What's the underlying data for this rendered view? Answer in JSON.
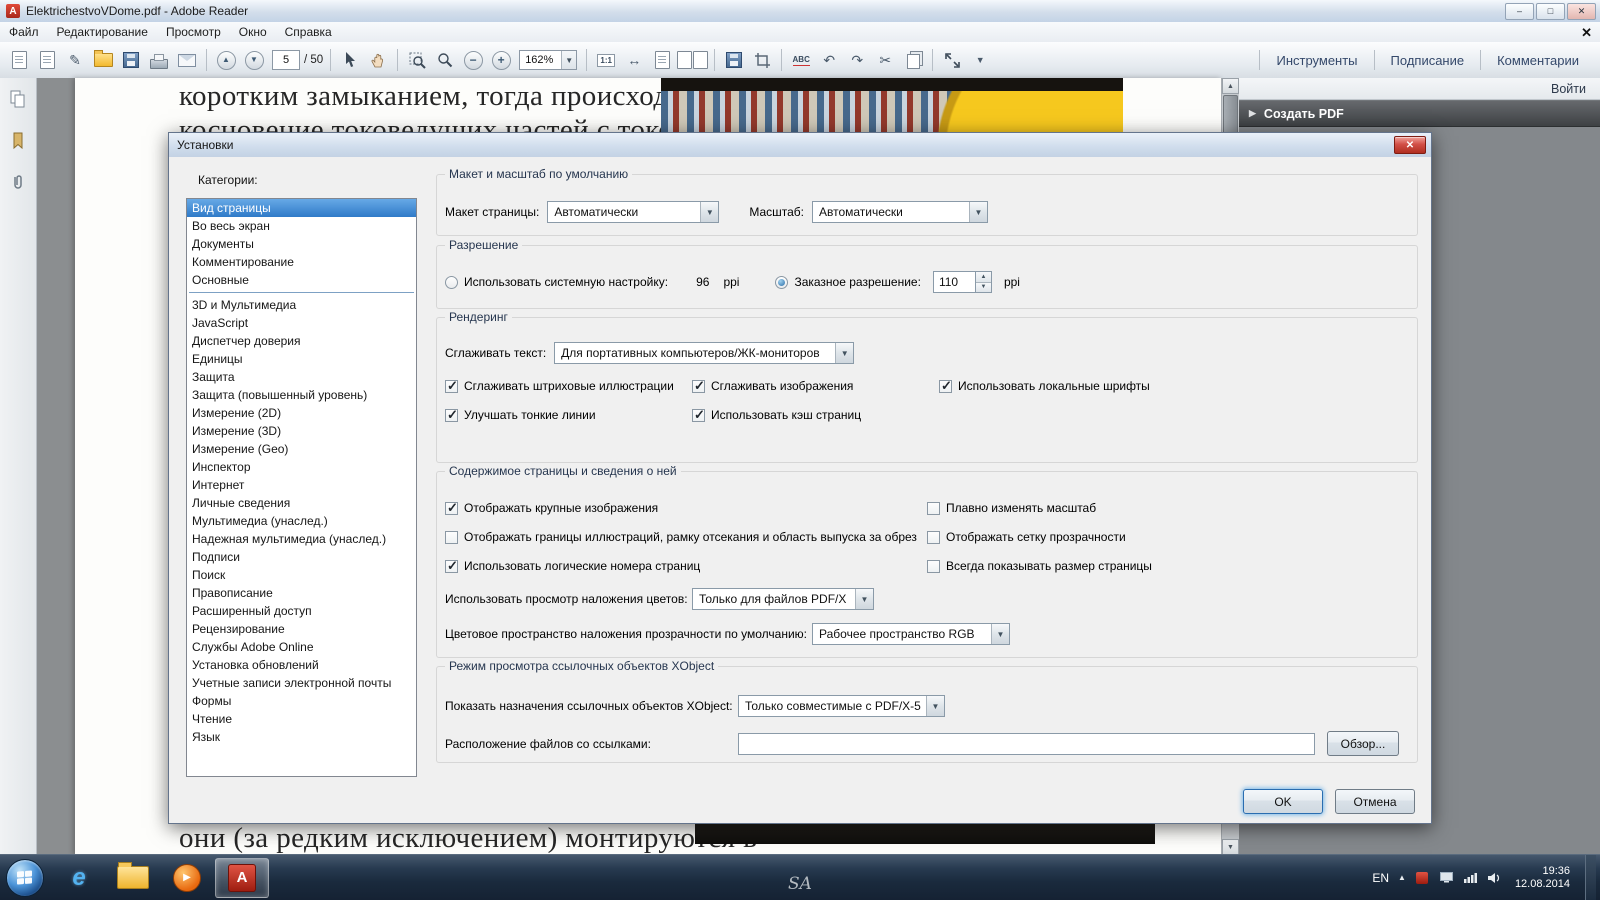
{
  "titlebar": {
    "title": "ElektrichestvoVDome.pdf - Adobe Reader"
  },
  "menubar": {
    "items": [
      "Файл",
      "Редактирование",
      "Просмотр",
      "Окно",
      "Справка"
    ]
  },
  "toolbar": {
    "page_current": "5",
    "page_total": "/ 50",
    "zoom": "162%",
    "links": [
      "Инструменты",
      "Подписание",
      "Комментарии"
    ]
  },
  "panel": {
    "signin": "Войти",
    "create_pdf": "Создать PDF"
  },
  "document": {
    "top_line1": "коротким замыканием, тогда происходит сопри-",
    "top_line2": "косновение токоведущих частей с токопрово-",
    "bottom_line": "они (за редким исключением) монтируются в"
  },
  "dialog": {
    "title": "Установки",
    "categories_label": "Категории:",
    "categories": [
      "Вид страницы",
      "Во весь экран",
      "Документы",
      "Комментирование",
      "Основные",
      "3D и Мультимедиа",
      "JavaScript",
      "Диспетчер доверия",
      "Единицы",
      "Защита",
      "Защита (повышенный уровень)",
      "Измерение (2D)",
      "Измерение (3D)",
      "Измерение (Geo)",
      "Инспектор",
      "Интернет",
      "Личные сведения",
      "Мультимедиа (унаслед.)",
      "Надежная мультимедиа (унаслед.)",
      "Подписи",
      "Поиск",
      "Правописание",
      "Расширенный доступ",
      "Рецензирование",
      "Службы Adobe Online",
      "Установка обновлений",
      "Учетные записи электронной почты",
      "Формы",
      "Чтение",
      "Язык"
    ],
    "layout_group": {
      "title": "Макет и масштаб по умолчанию",
      "page_layout_label": "Макет страницы:",
      "page_layout_value": "Автоматически",
      "zoom_label": "Масштаб:",
      "zoom_value": "Автоматически"
    },
    "resolution_group": {
      "title": "Разрешение",
      "system_label": "Использовать системную настройку:",
      "system_value": "96",
      "system_unit": "ppi",
      "custom_label": "Заказное разрешение:",
      "custom_value": "110",
      "custom_unit": "ppi"
    },
    "rendering_group": {
      "title": "Рендеринг",
      "smooth_text_label": "Сглаживать текст:",
      "smooth_text_value": "Для портативных компьютеров/ЖК-мониторов",
      "cb_line_art": "Сглаживать штриховые иллюстрации",
      "cb_images": "Сглаживать изображения",
      "cb_local_fonts": "Использовать локальные шрифты",
      "cb_thin_lines": "Улучшать тонкие линии",
      "cb_page_cache": "Использовать кэш страниц"
    },
    "content_group": {
      "title": "Содержимое страницы и сведения о ней",
      "cb_large_images": "Отображать крупные изображения",
      "cb_smooth_zoom": "Плавно изменять масштаб",
      "cb_art_box": "Отображать границы иллюстраций, рамку отсекания и область выпуска за обрез",
      "cb_transparency_grid": "Отображать сетку прозрачности",
      "cb_logical_pages": "Использовать логические номера страниц",
      "cb_page_size": "Всегда показывать размер страницы",
      "overprint_label": "Использовать просмотр наложения цветов:",
      "overprint_value": "Только для файлов PDF/X",
      "blend_label": "Цветовое пространство наложения прозрачности по умолчанию:",
      "blend_value": "Рабочее пространство RGB"
    },
    "xobject_group": {
      "title": "Режим просмотра ссылочных объектов XObject",
      "show_label": "Показать назначения ссылочных объектов XObject:",
      "show_value": "Только совместимые с PDF/X-5",
      "location_label": "Расположение файлов со ссылками:",
      "location_value": "",
      "browse_button": "Обзор..."
    },
    "ok_button": "OK",
    "cancel_button": "Отмена"
  },
  "taskbar": {
    "language": "EN",
    "time": "19:36",
    "date": "12.08.2014",
    "watermark": "SA"
  }
}
